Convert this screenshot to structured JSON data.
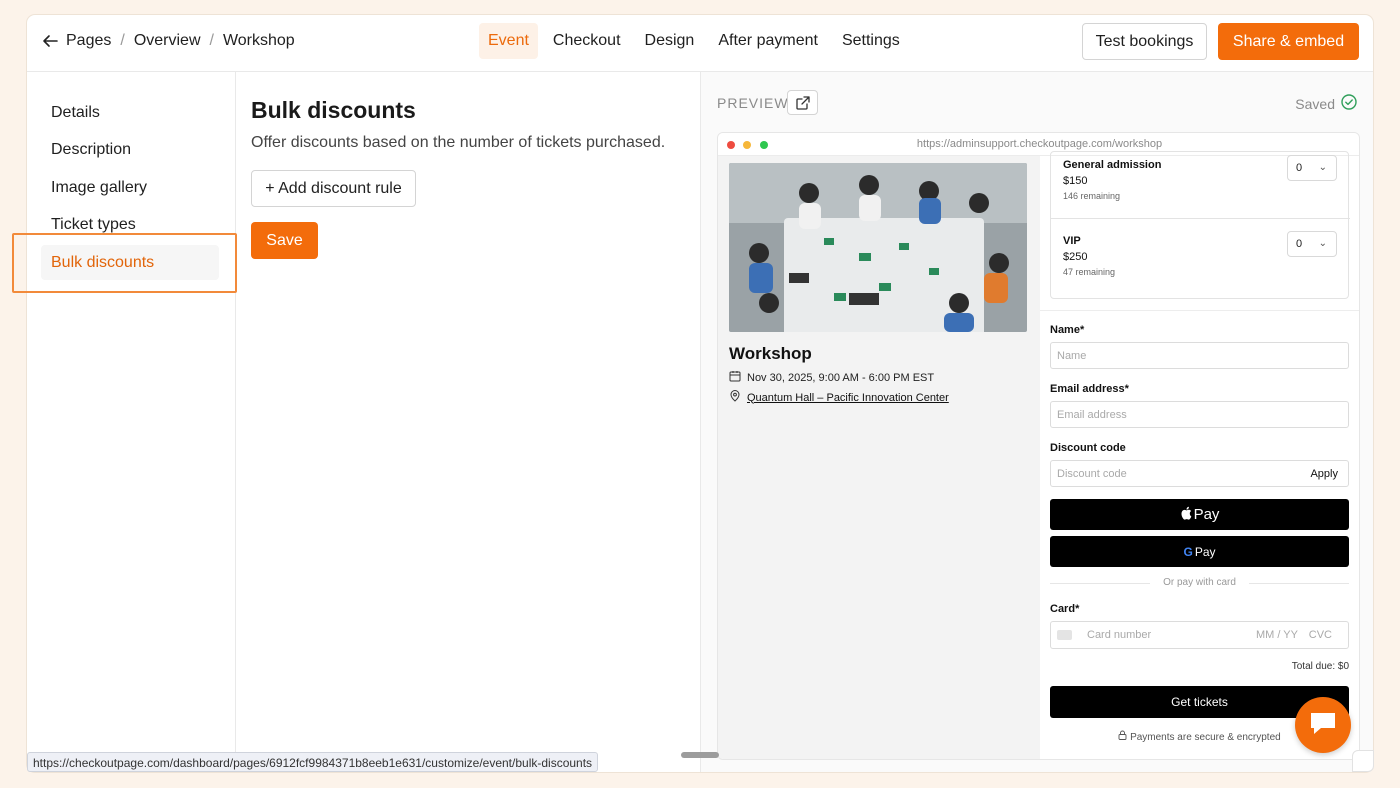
{
  "breadcrumb": [
    "Pages",
    "Overview",
    "Workshop"
  ],
  "tabs": [
    {
      "label": "Event",
      "active": true
    },
    {
      "label": "Checkout",
      "active": false
    },
    {
      "label": "Design",
      "active": false
    },
    {
      "label": "After payment",
      "active": false
    },
    {
      "label": "Settings",
      "active": false
    }
  ],
  "header": {
    "test_label": "Test bookings",
    "share_label": "Share & embed"
  },
  "sidebar": {
    "items": [
      {
        "label": "Details"
      },
      {
        "label": "Description"
      },
      {
        "label": "Image gallery"
      },
      {
        "label": "Ticket types"
      },
      {
        "label": "Bulk discounts",
        "active": true
      }
    ]
  },
  "main": {
    "title": "Bulk discounts",
    "subtitle": "Offer discounts based on the number of tickets purchased.",
    "add_label": "+ Add discount rule",
    "save_label": "Save"
  },
  "preview": {
    "label": "PREVIEW",
    "saved": "Saved",
    "url": "https://adminsupport.checkoutpage.com/workshop",
    "event": {
      "title": "Workshop",
      "date": "Nov 30, 2025, 9:00 AM - 6:00 PM EST",
      "location": "Quantum Hall – Pacific Innovation Center"
    },
    "tickets": [
      {
        "name": "General admission",
        "price": "$150",
        "remaining": "146 remaining",
        "qty": "0"
      },
      {
        "name": "VIP",
        "price": "$250",
        "remaining": "47 remaining",
        "qty": "0"
      }
    ],
    "form": {
      "name_label": "Name",
      "name_placeholder": "Name",
      "email_label": "Email address",
      "email_placeholder": "Email address",
      "discount_label": "Discount code",
      "discount_placeholder": "Discount code",
      "apply_label": "Apply",
      "apple_pay": "Pay",
      "google_pay": "Pay",
      "or_pay": "Or pay with card",
      "card_label": "Card",
      "card_number_placeholder": "Card number",
      "card_expiry_placeholder": "MM / YY",
      "card_cvc_placeholder": "CVC",
      "required_mark": "*",
      "total": "Total due: $0",
      "get_tickets": "Get tickets",
      "secure": "Payments are secure & encrypted"
    }
  },
  "status_url": "https://checkoutpage.com/dashboard/pages/6912fcf9984371b8eeb1e631/customize/event/bulk-discounts",
  "colors": {
    "accent": "#f36c0b",
    "accent_text": "#e2650a",
    "background": "#fcf3ea"
  }
}
